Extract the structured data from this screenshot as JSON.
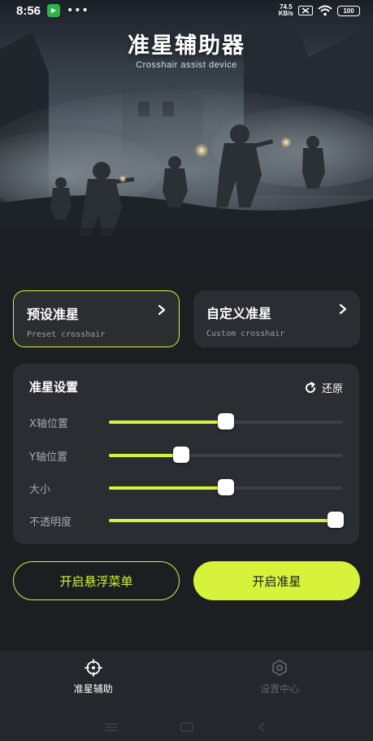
{
  "status_bar": {
    "time": "8:56",
    "dots": "•••",
    "net_speed_value": "74.5",
    "net_speed_unit": "KB/s",
    "battery": "100"
  },
  "hero": {
    "title": "准星辅助器",
    "subtitle": "Crosshair assist device"
  },
  "modes": [
    {
      "title": "预设准星",
      "subtitle": "Preset crosshair",
      "selected": true
    },
    {
      "title": "自定义准星",
      "subtitle": "Custom crosshair",
      "selected": false
    }
  ],
  "settings": {
    "title": "准星设置",
    "reset_label": "还原",
    "sliders": [
      {
        "label": "X轴位置",
        "value": 0.5
      },
      {
        "label": "Y轴位置",
        "value": 0.31
      },
      {
        "label": "大小",
        "value": 0.5
      },
      {
        "label": "不透明度",
        "value": 0.97
      }
    ]
  },
  "actions": {
    "floating_menu_label": "开启悬浮菜单",
    "enable_crosshair_label": "开启准星"
  },
  "bottom_nav": [
    {
      "label": "准星辅助",
      "icon": "crosshair-icon",
      "active": true
    },
    {
      "label": "设置中心",
      "icon": "settings-icon",
      "active": false
    }
  ],
  "colors": {
    "accent": "#d6f23a",
    "background": "#1c1f22",
    "card": "#2a2d31"
  }
}
